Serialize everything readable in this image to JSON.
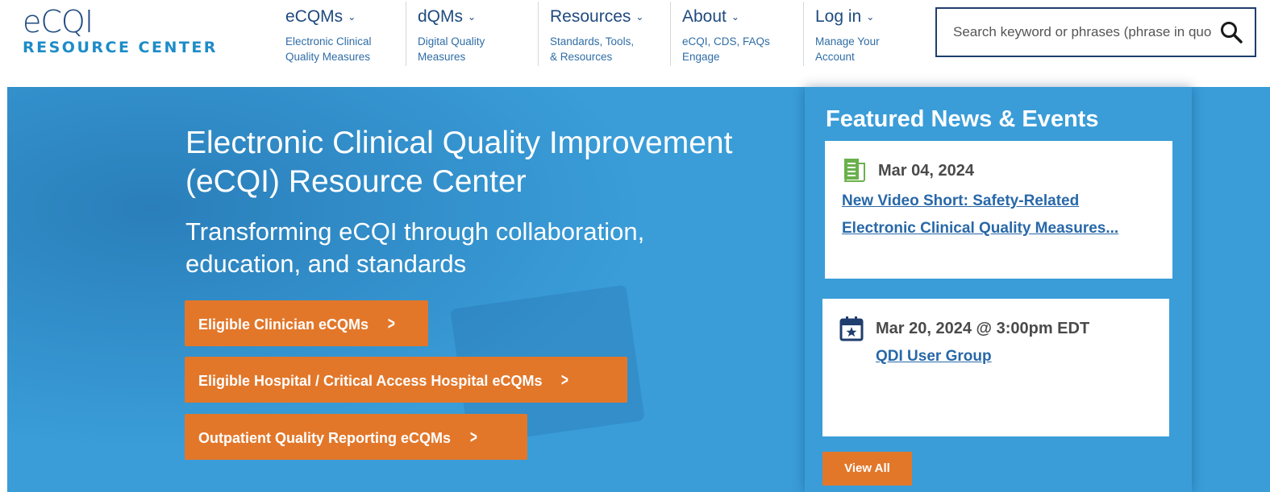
{
  "logo": {
    "main": "eCQI",
    "sub": "RESOURCE CENTER"
  },
  "nav": [
    {
      "title": "eCQMs",
      "desc1": "Electronic Clinical",
      "desc2": "Quality Measures"
    },
    {
      "title": "dQMs",
      "desc1": "Digital Quality",
      "desc2": "Measures"
    },
    {
      "title": "Resources",
      "desc1": "Standards, Tools,",
      "desc2": "& Resources"
    },
    {
      "title": "About",
      "desc1": "eCQI, CDS, FAQs",
      "desc2": "Engage"
    },
    {
      "title": "Log in",
      "desc1": "Manage Your",
      "desc2": "Account"
    }
  ],
  "search": {
    "placeholder": "Search keyword or phrases (phrase in quotes)"
  },
  "hero": {
    "title": "Electronic Clinical Quality Improvement (eCQI) Resource Center",
    "subtitle": "Transforming eCQI through collaboration, education, and standards",
    "buttons": [
      "Eligible Clinician eCQMs",
      "Eligible Hospital / Critical Access Hospital eCQMs",
      "Outpatient Quality Reporting eCQMs"
    ]
  },
  "featured": {
    "title": "Featured News & Events",
    "items": [
      {
        "date": "Mar 04, 2024",
        "link_line1": "New Video Short: Safety-Related",
        "link_line2": "Electronic Clinical Quality Measures...",
        "icon": "news-document-icon"
      },
      {
        "date": "Mar 20, 2024 @ 3:00pm EDT",
        "link_line1": "QDI User Group",
        "icon": "calendar-event-icon"
      }
    ],
    "view_all": "View All"
  },
  "colors": {
    "brand_blue": "#1f4a7f",
    "hero_blue": "#3a9dd8",
    "accent_orange": "#e2772a",
    "link_blue": "#2868a8",
    "news_icon_green": "#6ab04c"
  }
}
